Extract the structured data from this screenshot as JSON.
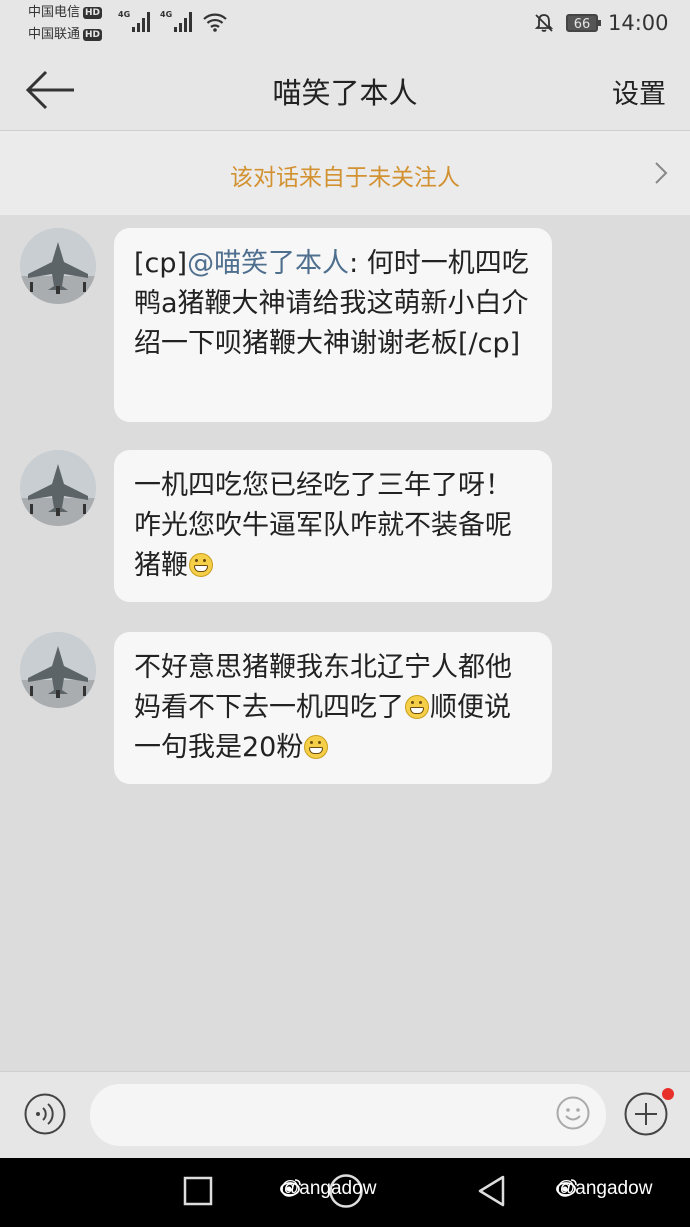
{
  "status_bar": {
    "carrier1": "中国电信",
    "carrier2": "中国联通",
    "hd_label": "HD",
    "network1": "4G",
    "network2": "4G",
    "battery": "66",
    "time": "14:00"
  },
  "nav": {
    "title": "喵笑了本人",
    "settings_label": "设置"
  },
  "notice": {
    "text": "该对话来自于未关注人"
  },
  "messages": [
    {
      "prefix": "[cp]",
      "mention": "@喵笑了本人",
      "text": ": 何时一机四吃鸭a猪鞭大神请给我这萌新小白介绍一下呗猪鞭大神谢谢老板[/cp]"
    },
    {
      "part1": "一机四吃您已经吃了三年了呀！咋光您吹牛逼军队咋就不装备呢猪鞭"
    },
    {
      "part1": "不好意思猪鞭我东北辽宁人都他妈看不下去一机四吃了",
      "part2": "顺便说一句我是20粉"
    }
  ],
  "input_bar": {
    "placeholder": ""
  },
  "watermarks": [
    "@angadow",
    "@angadow"
  ]
}
